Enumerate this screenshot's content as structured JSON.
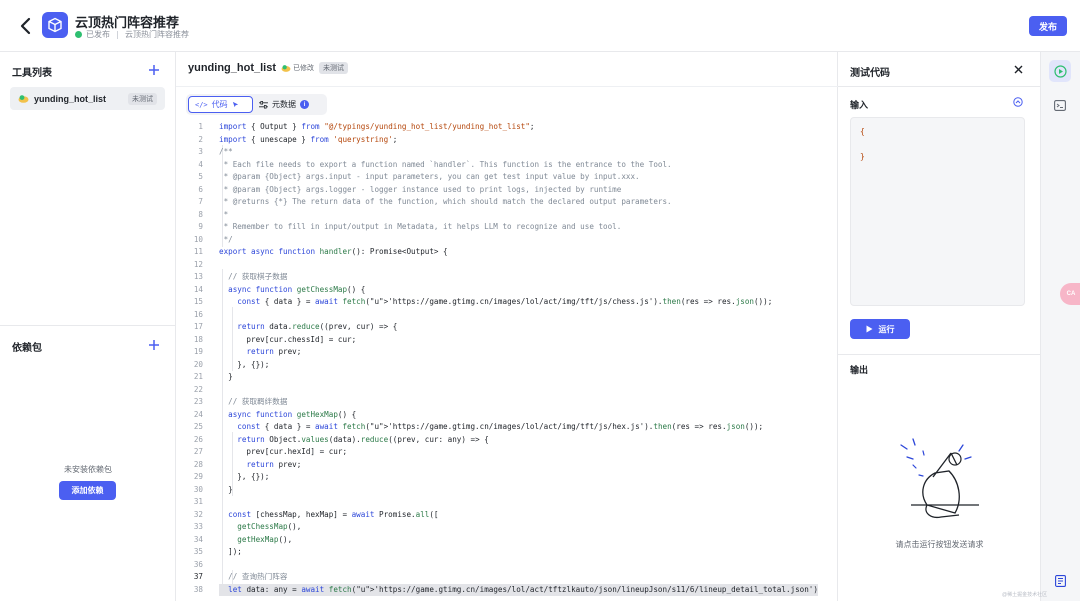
{
  "header": {
    "title": "云顶热门阵容推荐",
    "status": "已发布",
    "breadcrumb": "云顶热门阵容推荐",
    "publish_label": "发布"
  },
  "sidebar": {
    "tools_title": "工具列表",
    "tool": {
      "name": "yunding_hot_list",
      "tag": "未测试"
    },
    "deps_title": "依赖包",
    "deps_empty": "未安装依赖包",
    "add_dep_label": "添加依赖"
  },
  "editor": {
    "file_name": "yunding_hot_list",
    "modified_label": "已修改",
    "test_tag": "未测试",
    "tabs": [
      {
        "label": "代码"
      },
      {
        "label": "元数据"
      }
    ],
    "lines": [
      {
        "n": "1",
        "t": "import { Output } from \"@/typings/yunding_hot_list/yunding_hot_list\";"
      },
      {
        "n": "2",
        "t": "import { unescape } from 'querystring';"
      },
      {
        "n": "3",
        "t": "/**"
      },
      {
        "n": "4",
        "t": " * Each file needs to export a function named `handler`. This function is the entrance to the Tool."
      },
      {
        "n": "5",
        "t": " * @param {Object} args.input - input parameters, you can get test input value by input.xxx."
      },
      {
        "n": "6",
        "t": " * @param {Object} args.logger - logger instance used to print logs, injected by runtime"
      },
      {
        "n": "7",
        "t": " * @returns {*} The return data of the function, which should match the declared output parameters."
      },
      {
        "n": "8",
        "t": " *"
      },
      {
        "n": "9",
        "t": " * Remember to fill in input/output in Metadata, it helps LLM to recognize and use tool."
      },
      {
        "n": "10",
        "t": " */"
      },
      {
        "n": "11",
        "t": "export async function handler(): Promise<Output> {"
      },
      {
        "n": "12",
        "t": ""
      },
      {
        "n": "13",
        "t": "  // 获取棋子数据"
      },
      {
        "n": "14",
        "t": "  async function getChessMap() {"
      },
      {
        "n": "15",
        "t": "    const { data } = await fetch('https://game.gtimg.cn/images/lol/act/img/tft/js/chess.js').then(res => res.json());"
      },
      {
        "n": "16",
        "t": ""
      },
      {
        "n": "17",
        "t": "    return data.reduce((prev, cur) => {"
      },
      {
        "n": "18",
        "t": "      prev[cur.chessId] = cur;"
      },
      {
        "n": "19",
        "t": "      return prev;"
      },
      {
        "n": "20",
        "t": "    }, {});"
      },
      {
        "n": "21",
        "t": "  }"
      },
      {
        "n": "22",
        "t": ""
      },
      {
        "n": "23",
        "t": "  // 获取羁绊数据"
      },
      {
        "n": "24",
        "t": "  async function getHexMap() {"
      },
      {
        "n": "25",
        "t": "    const { data } = await fetch('https://game.gtimg.cn/images/lol/act/img/tft/js/hex.js').then(res => res.json());"
      },
      {
        "n": "26",
        "t": "    return Object.values(data).reduce((prev, cur: any) => {"
      },
      {
        "n": "27",
        "t": "      prev[cur.hexId] = cur;"
      },
      {
        "n": "28",
        "t": "      return prev;"
      },
      {
        "n": "29",
        "t": "    }, {});"
      },
      {
        "n": "30",
        "t": "  }"
      },
      {
        "n": "31",
        "t": ""
      },
      {
        "n": "32",
        "t": "  const [chessMap, hexMap] = await Promise.all(["
      },
      {
        "n": "33",
        "t": "    getChessMap(),"
      },
      {
        "n": "34",
        "t": "    getHexMap(),"
      },
      {
        "n": "35",
        "t": "  ]);"
      },
      {
        "n": "36",
        "t": ""
      },
      {
        "n": "37",
        "t": "  // 查询热门阵容"
      },
      {
        "n": "38",
        "t": "  let data: any = await fetch('https://game.gtimg.cn/images/lol/act/tftzlkauto/json/lineupJson/s11/6/lineup_detail_total.json')"
      }
    ]
  },
  "test_panel": {
    "title": "测试代码",
    "input_label": "输入",
    "input_value": "{\n\n}",
    "run_label": "运行",
    "output_label": "输出",
    "output_empty": "请点击运行按钮发送请求"
  },
  "float_tab": "CA",
  "watermark": "@稀土掘金技术社区",
  "colors": {
    "accent": "#4b5ff1",
    "success": "#2fbf71",
    "string": "#b5470c",
    "keyword": "#2c46d9"
  }
}
